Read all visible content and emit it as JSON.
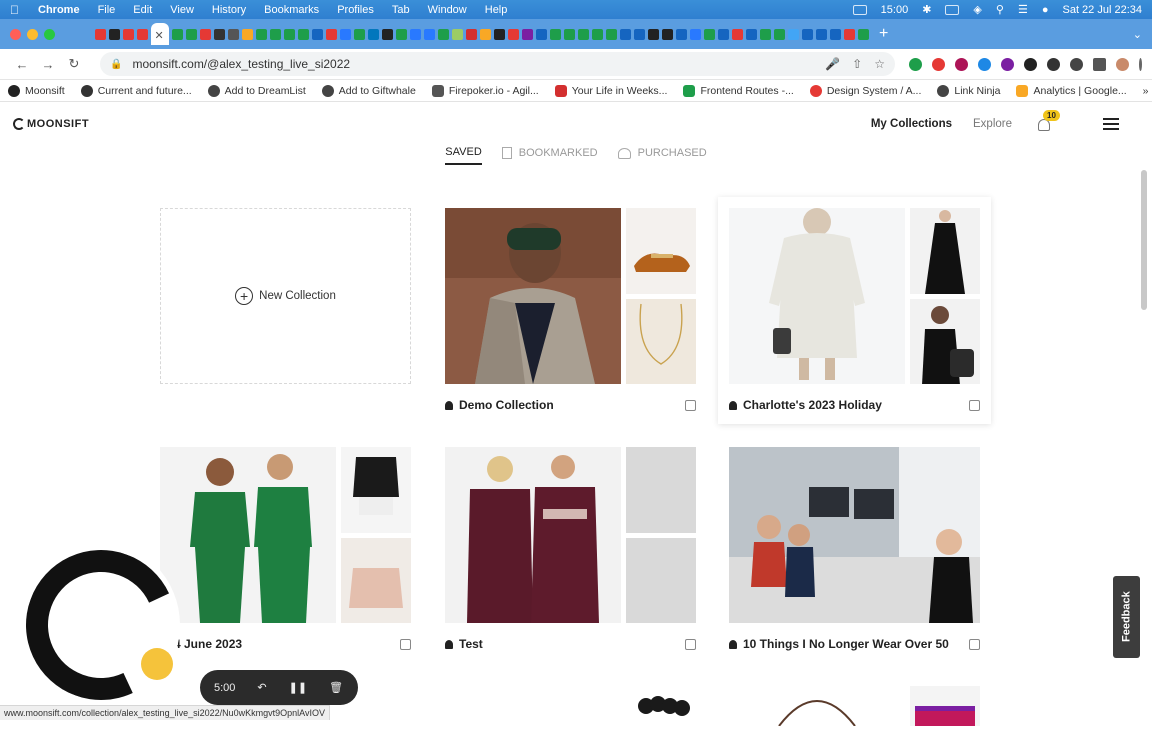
{
  "menubar": {
    "app": "Chrome",
    "items": [
      "File",
      "Edit",
      "View",
      "History",
      "Bookmarks",
      "Profiles",
      "Tab",
      "Window",
      "Help"
    ],
    "time": "15:00",
    "datetime": "Sat 22 Jul  22:34"
  },
  "browser": {
    "url": "moonsift.com/@alex_testing_live_si2022",
    "bookmarks": [
      {
        "label": "Moonsift",
        "color": "#222222"
      },
      {
        "label": "Current and future...",
        "color": "#333333"
      },
      {
        "label": "Add to DreamList",
        "color": "#444444"
      },
      {
        "label": "Add to Giftwhale",
        "color": "#444444"
      },
      {
        "label": "Firepoker.io - Agil...",
        "color": "#555555"
      },
      {
        "label": "Your Life in Weeks...",
        "color": "#d32f2f"
      },
      {
        "label": "Frontend Routes -...",
        "color": "#1e9e4a"
      },
      {
        "label": "Design System / A...",
        "color": "#e53935"
      },
      {
        "label": "Link Ninja",
        "color": "#444444"
      },
      {
        "label": "Analytics | Google...",
        "color": "#f9a825"
      }
    ],
    "status_url": "www.moonsift.com/collection/alex_testing_live_si2022/Nu0wKkmgvt9OpnlAvIOV"
  },
  "site": {
    "logo": "MOONSIFT",
    "nav": {
      "my_collections": "My Collections",
      "explore": "Explore"
    },
    "notifications": "10"
  },
  "tabs": {
    "saved": "SAVED",
    "bookmarked": "BOOKMARKED",
    "purchased": "PURCHASED"
  },
  "new_collection": "New Collection",
  "collections": [
    {
      "title": "Demo Collection"
    },
    {
      "title": "Charlotte's 2023 Holiday"
    },
    {
      "title": "4 June 2023"
    },
    {
      "title": "Test"
    },
    {
      "title": "10 Things I No Longer Wear Over 50"
    }
  ],
  "feedback": "Feedback",
  "recorder": {
    "timer": "5:00"
  }
}
